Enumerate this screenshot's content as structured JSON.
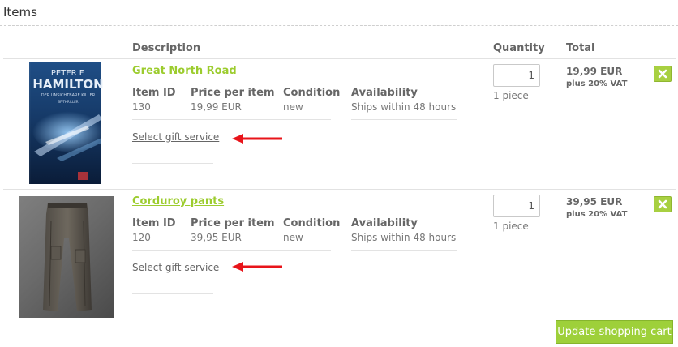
{
  "section": {
    "title": "Items"
  },
  "columns": {
    "description": "Description",
    "quantity": "Quantity",
    "total": "Total"
  },
  "labels": {
    "item_id": "Item ID",
    "price_per_item": "Price per item",
    "condition": "Condition",
    "availability": "Availability",
    "gift_service": "Select gift service"
  },
  "items": [
    {
      "title": "Great North Road",
      "item_id": "130",
      "price": "19,99  EUR",
      "condition": "new",
      "availability": "Ships within 48 hours",
      "quantity": "1",
      "quantity_unit": "1 piece",
      "total": "19,99  EUR",
      "vat": "plus 20% VAT",
      "cover": {
        "author_line1": "PETER F.",
        "author_line2": "HAMILTON",
        "subtitle": "DER UNSICHTBARE KILLER",
        "genre": "SF-THRILLER"
      }
    },
    {
      "title": "Corduroy pants",
      "item_id": "120",
      "price": "39,95  EUR",
      "condition": "new",
      "availability": "Ships within 48 hours",
      "quantity": "1",
      "quantity_unit": "1 piece",
      "total": "39,95  EUR",
      "vat": "plus 20% VAT"
    }
  ],
  "actions": {
    "update_cart": "Update shopping cart"
  },
  "colors": {
    "accent_green": "#9ccc2e",
    "button_green": "#9ed03a",
    "annotation_red": "#e8141a"
  }
}
